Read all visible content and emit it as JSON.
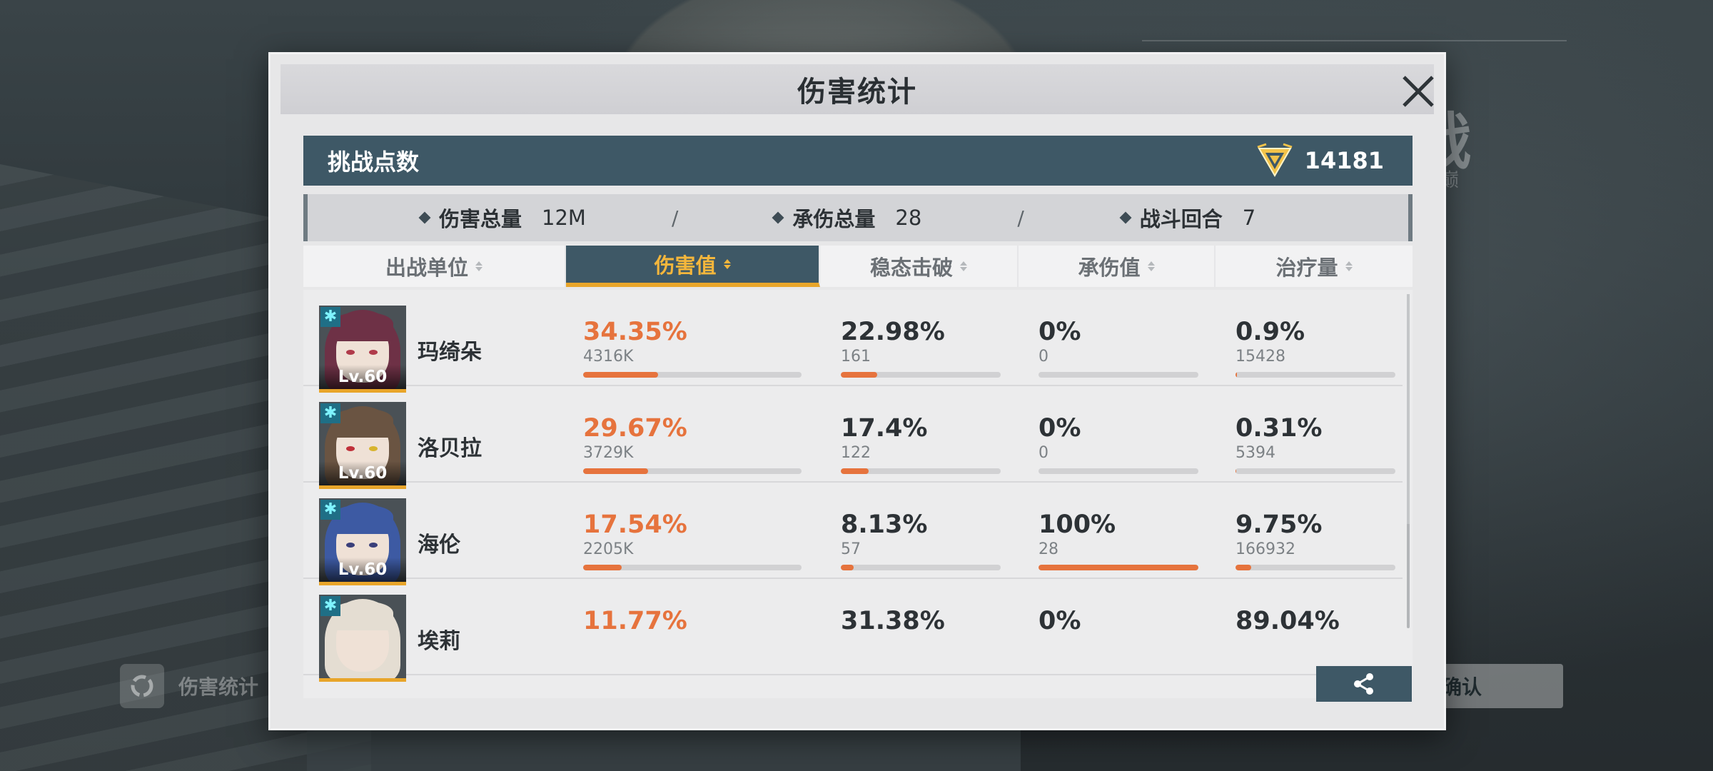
{
  "background": {
    "title_partial": "战",
    "subtitle_partial": "巅",
    "left_button_label": "伤害统计",
    "confirm_label": "确认"
  },
  "dialog": {
    "title": "伤害统计",
    "challenge_points": {
      "label": "挑战点数",
      "value": "14181"
    },
    "summary": {
      "damage_total": {
        "label": "伤害总量",
        "value": "12M"
      },
      "damage_taken_total": {
        "label": "承伤总量",
        "value": "28"
      },
      "battle_rounds": {
        "label": "战斗回合",
        "value": "7"
      },
      "separator": "/"
    },
    "columns": [
      "出战单位",
      "伤害值",
      "稳态击破",
      "承伤值",
      "治疗量"
    ],
    "active_column_index": 1,
    "rows": [
      {
        "name": "玛绮朵",
        "level": "Lv.60",
        "hair_color": "#6e3146",
        "damage": {
          "pct": "34.35%",
          "raw": "4316K",
          "ratio": 0.3435
        },
        "break": {
          "pct": "22.98%",
          "raw": "161",
          "ratio": 0.2298
        },
        "taken": {
          "pct": "0%",
          "raw": "0",
          "ratio": 0
        },
        "heal": {
          "pct": "0.9%",
          "raw": "15428",
          "ratio": 0.009
        }
      },
      {
        "name": "洛贝拉",
        "level": "Lv.60",
        "hair_color": "#6a5442",
        "damage": {
          "pct": "29.67%",
          "raw": "3729K",
          "ratio": 0.2967
        },
        "break": {
          "pct": "17.4%",
          "raw": "122",
          "ratio": 0.174
        },
        "taken": {
          "pct": "0%",
          "raw": "0",
          "ratio": 0
        },
        "heal": {
          "pct": "0.31%",
          "raw": "5394",
          "ratio": 0.0031
        }
      },
      {
        "name": "海伦",
        "level": "Lv.60",
        "hair_color": "#3d5aa3",
        "damage": {
          "pct": "17.54%",
          "raw": "2205K",
          "ratio": 0.1754
        },
        "break": {
          "pct": "8.13%",
          "raw": "57",
          "ratio": 0.0813
        },
        "taken": {
          "pct": "100%",
          "raw": "28",
          "ratio": 1.0
        },
        "heal": {
          "pct": "9.75%",
          "raw": "166932",
          "ratio": 0.0975
        }
      },
      {
        "name": "埃莉",
        "level": "",
        "hair_color": "#e4ddd2",
        "damage": {
          "pct": "11.77%",
          "raw": "",
          "ratio": 0.1177
        },
        "break": {
          "pct": "31.38%",
          "raw": "",
          "ratio": 0.3138
        },
        "taken": {
          "pct": "0%",
          "raw": "",
          "ratio": 0
        },
        "heal": {
          "pct": "89.04%",
          "raw": "",
          "ratio": 0.8904
        }
      }
    ]
  },
  "colors": {
    "accent_bar": "#e6733d",
    "header_teal": "#3e5866",
    "active_tab_text": "#f4b63c",
    "active_tab_underline": "#e8a52a"
  },
  "icons": [
    "close-icon",
    "challenge-emblem-icon",
    "sort-icon",
    "share-icon",
    "star-element-icon"
  ]
}
